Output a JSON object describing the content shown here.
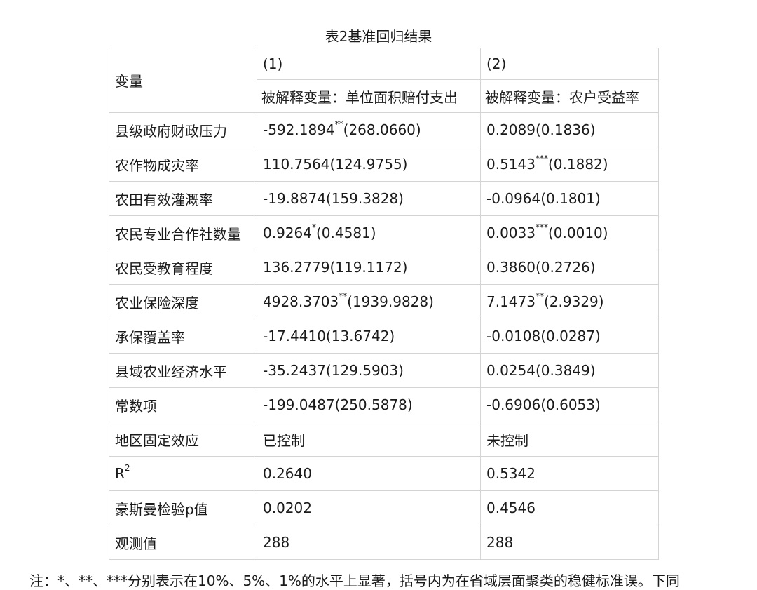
{
  "title": "表2基准回归结果",
  "header": {
    "variable": "变量",
    "col1": "(1)",
    "col2": "(2)",
    "dep1": "被解释变量：单位面积赔付支出",
    "dep2": "被解释变量：农户受益率"
  },
  "rows": [
    {
      "name": "县级政府财政压力",
      "c1": "-592.1894",
      "c1_sig": "**",
      "c1_se": "(268.0660)",
      "c2": "0.2089",
      "c2_sig": "",
      "c2_se": "(0.1836)"
    },
    {
      "name": "农作物成灾率",
      "c1": "110.7564",
      "c1_sig": "",
      "c1_se": "(124.9755)",
      "c2": "0.5143",
      "c2_sig": "***",
      "c2_se": "(0.1882)"
    },
    {
      "name": "农田有效灌溉率",
      "c1": "-19.8874",
      "c1_sig": "",
      "c1_se": "(159.3828)",
      "c2": "-0.0964",
      "c2_sig": "",
      "c2_se": "(0.1801)"
    },
    {
      "name": "农民专业合作社数量",
      "c1": "0.9264",
      "c1_sig": "*",
      "c1_se": "(0.4581)",
      "c2": "0.0033",
      "c2_sig": "***",
      "c2_se": "(0.0010)"
    },
    {
      "name": "农民受教育程度",
      "c1": "136.2779",
      "c1_sig": "",
      "c1_se": "(119.1172)",
      "c2": "0.3860",
      "c2_sig": "",
      "c2_se": "(0.2726)"
    },
    {
      "name": "农业保险深度",
      "c1": "4928.3703",
      "c1_sig": "**",
      "c1_se": "(1939.9828)",
      "c2": "7.1473",
      "c2_sig": "**",
      "c2_se": "(2.9329)"
    },
    {
      "name": "承保覆盖率",
      "c1": "-17.4410",
      "c1_sig": "",
      "c1_se": "(13.6742)",
      "c2": "-0.0108",
      "c2_sig": "",
      "c2_se": "(0.0287)"
    },
    {
      "name": "县域农业经济水平",
      "c1": "-35.2437",
      "c1_sig": "",
      "c1_se": "(129.5903)",
      "c2": "0.0254",
      "c2_sig": "",
      "c2_se": "(0.3849)"
    },
    {
      "name": "常数项",
      "c1": "-199.0487",
      "c1_sig": "",
      "c1_se": "(250.5878)",
      "c2": "-0.6906",
      "c2_sig": "",
      "c2_se": "(0.6053)"
    },
    {
      "name": "地区固定效应",
      "c1": "已控制",
      "c1_sig": "",
      "c1_se": "",
      "c2": "未控制",
      "c2_sig": "",
      "c2_se": ""
    },
    {
      "name": "R",
      "name_sup": "2",
      "c1": "0.2640",
      "c1_sig": "",
      "c1_se": "",
      "c2": "0.5342",
      "c2_sig": "",
      "c2_se": ""
    },
    {
      "name": "豪斯曼检验p值",
      "c1": "0.0202",
      "c1_sig": "",
      "c1_se": "",
      "c2": "0.4546",
      "c2_sig": "",
      "c2_se": ""
    },
    {
      "name": "观测值",
      "c1": "288",
      "c1_sig": "",
      "c1_se": "",
      "c2": "288",
      "c2_sig": "",
      "c2_se": ""
    }
  ],
  "note": "注：*、**、***分别表示在10%、5%、1%的水平上显著，括号内为在省域层面聚类的稳健标准误。下同"
}
